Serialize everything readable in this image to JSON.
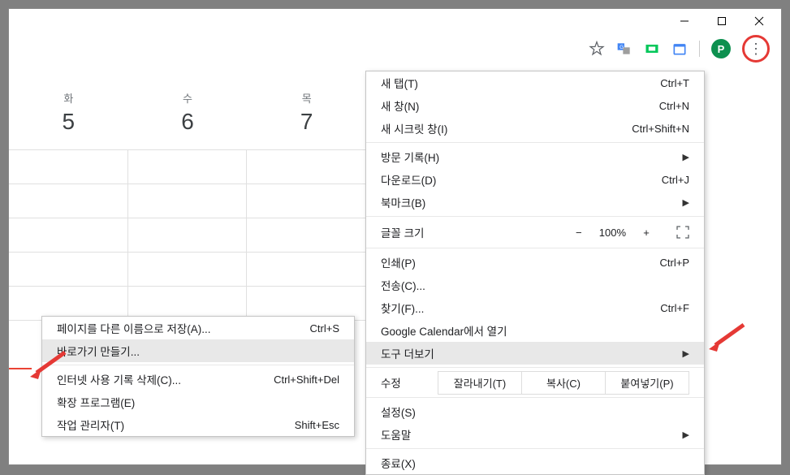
{
  "window": {
    "minimize": "—",
    "maximize": "❐",
    "close": "✕"
  },
  "toolbar": {
    "star": "☆",
    "avatar_letter": "P"
  },
  "calendar": {
    "days": [
      {
        "name": "화",
        "num": "5"
      },
      {
        "name": "수",
        "num": "6"
      },
      {
        "name": "목",
        "num": "7"
      }
    ]
  },
  "main_menu": {
    "new_tab": {
      "label": "새 탭(T)",
      "shortcut": "Ctrl+T"
    },
    "new_window": {
      "label": "새 창(N)",
      "shortcut": "Ctrl+N"
    },
    "new_incognito": {
      "label": "새 시크릿 창(I)",
      "shortcut": "Ctrl+Shift+N"
    },
    "history": {
      "label": "방문 기록(H)"
    },
    "downloads": {
      "label": "다운로드(D)",
      "shortcut": "Ctrl+J"
    },
    "bookmarks": {
      "label": "북마크(B)"
    },
    "zoom": {
      "label": "글꼴 크기",
      "minus": "−",
      "value": "100%",
      "plus": "+"
    },
    "print": {
      "label": "인쇄(P)",
      "shortcut": "Ctrl+P"
    },
    "cast": {
      "label": "전송(C)..."
    },
    "find": {
      "label": "찾기(F)...",
      "shortcut": "Ctrl+F"
    },
    "open_in_app": {
      "label": "Google Calendar에서 열기"
    },
    "more_tools": {
      "label": "도구 더보기"
    },
    "edit": {
      "label": "수정",
      "cut": "잘라내기(T)",
      "copy": "복사(C)",
      "paste": "붙여넣기(P)"
    },
    "settings": {
      "label": "설정(S)"
    },
    "help": {
      "label": "도움말"
    },
    "exit": {
      "label": "종료(X)"
    }
  },
  "sub_menu": {
    "save_as": {
      "label": "페이지를 다른 이름으로 저장(A)...",
      "shortcut": "Ctrl+S"
    },
    "create_shortcut": {
      "label": "바로가기 만들기..."
    },
    "clear_browsing": {
      "label": "인터넷 사용 기록 삭제(C)...",
      "shortcut": "Ctrl+Shift+Del"
    },
    "extensions": {
      "label": "확장 프로그램(E)"
    },
    "task_manager": {
      "label": "작업 관리자(T)",
      "shortcut": "Shift+Esc"
    }
  }
}
